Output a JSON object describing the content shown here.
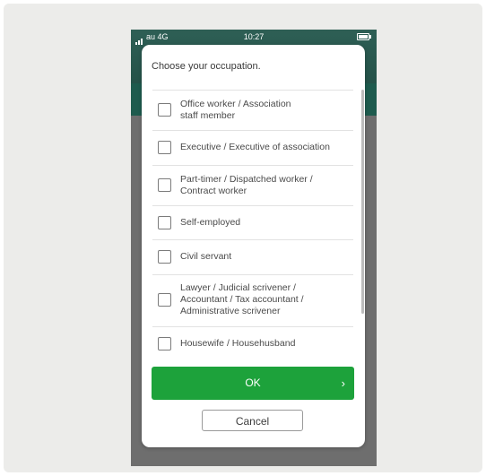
{
  "status_bar": {
    "carrier": "au 4G",
    "time": "10:27"
  },
  "dialog": {
    "title": "Choose your occupation.",
    "options": [
      {
        "label": "Office worker / Association\nstaff member",
        "checked": false
      },
      {
        "label": "Executive / Executive of association",
        "checked": false
      },
      {
        "label": "Part-timer / Dispatched worker /\nContract worker",
        "checked": false
      },
      {
        "label": "Self-employed",
        "checked": false
      },
      {
        "label": "Civil servant",
        "checked": false
      },
      {
        "label": "Lawyer / Judicial scrivener /\nAccountant / Tax accountant /\nAdministrative scrivener",
        "checked": false
      },
      {
        "label": "Housewife / Househusband",
        "checked": false
      }
    ],
    "ok_label": "OK",
    "ok_icon": "chevron-right-icon",
    "cancel_label": "Cancel"
  },
  "colors": {
    "ok_button": "#1da23b",
    "header_teal": "#1e5b4e",
    "overlay": "#6e6e6e"
  }
}
